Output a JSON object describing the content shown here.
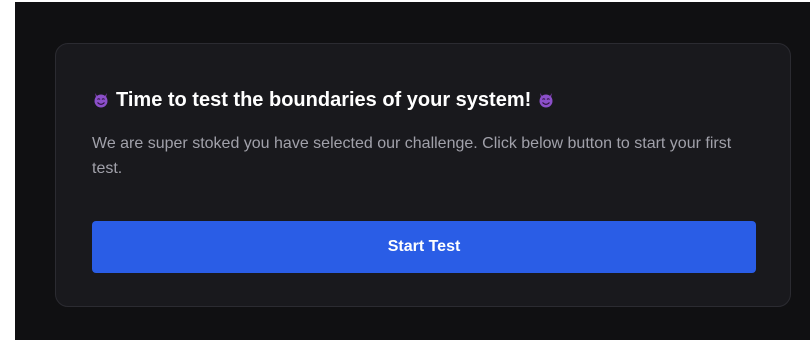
{
  "card": {
    "title": "Time to test the boundaries of your system!",
    "title_icon": "smiling-devil-emoji",
    "description": "We are super stoked you have selected our challenge. Click below button to start your first test.",
    "button_label": "Start Test"
  },
  "colors": {
    "background": "#101012",
    "card": "#19191d",
    "card_border": "#2b2b31",
    "accent": "#2a5de6",
    "title": "#ffffff",
    "description": "#a1a1aa",
    "emoji": "#8b4fc9"
  }
}
